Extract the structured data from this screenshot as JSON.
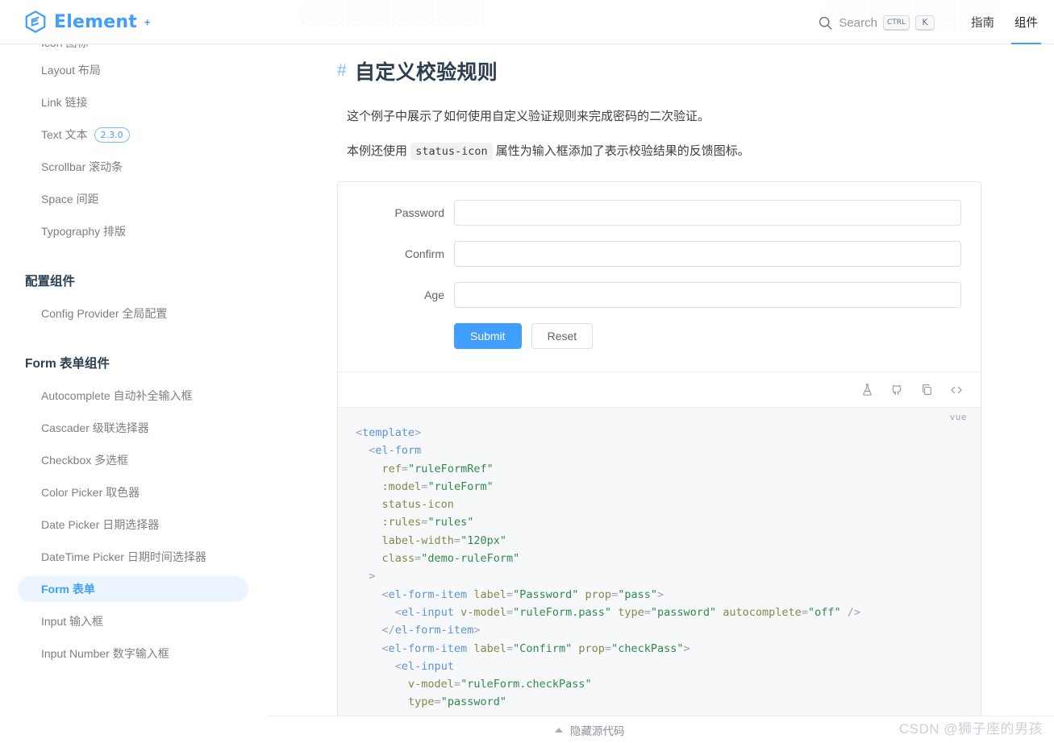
{
  "header": {
    "brand": "Element",
    "brand_plus": "+",
    "logo_icon": "element-hex-logo-icon",
    "search": {
      "icon": "search-icon",
      "label": "Search",
      "kbd_ctrl": "CTRL",
      "kbd_key": "K"
    },
    "nav": [
      {
        "label": "指南",
        "active": false
      },
      {
        "label": "组件",
        "active": true
      }
    ]
  },
  "sidebar": {
    "items": [
      {
        "label": "Icon 图标",
        "type": "link",
        "active": false,
        "clipped": true
      },
      {
        "label": "Layout 布局",
        "type": "link",
        "active": false
      },
      {
        "label": "Link 链接",
        "type": "link",
        "active": false
      },
      {
        "label": "Text 文本",
        "type": "link",
        "active": false,
        "badge": "2.3.0"
      },
      {
        "label": "Scrollbar 滚动条",
        "type": "link",
        "active": false
      },
      {
        "label": "Space 间距",
        "type": "link",
        "active": false
      },
      {
        "label": "Typography 排版",
        "type": "link",
        "active": false
      },
      {
        "label": "配置组件",
        "type": "group"
      },
      {
        "label": "Config Provider 全局配置",
        "type": "link",
        "active": false
      },
      {
        "label": "Form 表单组件",
        "type": "group"
      },
      {
        "label": "Autocomplete 自动补全输入框",
        "type": "link",
        "active": false
      },
      {
        "label": "Cascader 级联选择器",
        "type": "link",
        "active": false
      },
      {
        "label": "Checkbox 多选框",
        "type": "link",
        "active": false
      },
      {
        "label": "Color Picker 取色器",
        "type": "link",
        "active": false
      },
      {
        "label": "Date Picker 日期选择器",
        "type": "link",
        "active": false
      },
      {
        "label": "DateTime Picker 日期时间选择器",
        "type": "link",
        "active": false
      },
      {
        "label": "Form 表单",
        "type": "link",
        "active": true
      },
      {
        "label": "Input 输入框",
        "type": "link",
        "active": false
      },
      {
        "label": "Input Number 数字输入框",
        "type": "link",
        "active": false
      }
    ]
  },
  "main": {
    "heading_anchor": "#",
    "heading": "自定义校验规则",
    "paragraph_1": "这个例子中展示了如何使用自定义验证规则来完成密码的二次验证。",
    "paragraph_2_before": "本例还使用",
    "paragraph_2_code": "status-icon",
    "paragraph_2_after": "属性为输入框添加了表示校验结果的反馈图标。",
    "demo": {
      "fields": [
        {
          "label": "Password",
          "value": "",
          "placeholder": "",
          "type": "password",
          "name": "password-input"
        },
        {
          "label": "Confirm",
          "value": "",
          "placeholder": "",
          "type": "password",
          "name": "confirm-input"
        },
        {
          "label": "Age",
          "value": "",
          "placeholder": "",
          "type": "text",
          "name": "age-input"
        }
      ],
      "submit_label": "Submit",
      "reset_label": "Reset",
      "toolbar_icons": [
        {
          "name": "playground-flask-icon",
          "title": "在 Playground 中编辑"
        },
        {
          "name": "github-icon",
          "title": "在 GitHub 上查看"
        },
        {
          "name": "copy-icon",
          "title": "复制代码"
        },
        {
          "name": "code-brackets-icon",
          "title": "查看源代码"
        }
      ],
      "code_lang": "vue"
    },
    "footer": {
      "toggle_icon": "caret-up-icon",
      "toggle_label": "隐藏源代码"
    }
  },
  "code_lines": [
    [
      {
        "t": "punc",
        "v": "<"
      },
      {
        "t": "tag",
        "v": "template"
      },
      {
        "t": "punc",
        "v": ">"
      }
    ],
    [
      {
        "t": "plain",
        "v": "  "
      },
      {
        "t": "punc",
        "v": "<"
      },
      {
        "t": "tag",
        "v": "el-form"
      }
    ],
    [
      {
        "t": "plain",
        "v": "    "
      },
      {
        "t": "attr",
        "v": "ref"
      },
      {
        "t": "eq",
        "v": "="
      },
      {
        "t": "str",
        "v": "\"ruleFormRef\""
      }
    ],
    [
      {
        "t": "plain",
        "v": "    "
      },
      {
        "t": "attr",
        "v": ":model"
      },
      {
        "t": "eq",
        "v": "="
      },
      {
        "t": "str",
        "v": "\"ruleForm\""
      }
    ],
    [
      {
        "t": "plain",
        "v": "    "
      },
      {
        "t": "attr",
        "v": "status-icon"
      }
    ],
    [
      {
        "t": "plain",
        "v": "    "
      },
      {
        "t": "attr",
        "v": ":rules"
      },
      {
        "t": "eq",
        "v": "="
      },
      {
        "t": "str",
        "v": "\"rules\""
      }
    ],
    [
      {
        "t": "plain",
        "v": "    "
      },
      {
        "t": "attr",
        "v": "label-width"
      },
      {
        "t": "eq",
        "v": "="
      },
      {
        "t": "str",
        "v": "\"120px\""
      }
    ],
    [
      {
        "t": "plain",
        "v": "    "
      },
      {
        "t": "attr",
        "v": "class"
      },
      {
        "t": "eq",
        "v": "="
      },
      {
        "t": "str",
        "v": "\"demo-ruleForm\""
      }
    ],
    [
      {
        "t": "plain",
        "v": "  "
      },
      {
        "t": "punc",
        "v": ">"
      }
    ],
    [
      {
        "t": "plain",
        "v": "    "
      },
      {
        "t": "punc",
        "v": "<"
      },
      {
        "t": "tag",
        "v": "el-form-item"
      },
      {
        "t": "plain",
        "v": " "
      },
      {
        "t": "attr",
        "v": "label"
      },
      {
        "t": "eq",
        "v": "="
      },
      {
        "t": "str",
        "v": "\"Password\""
      },
      {
        "t": "plain",
        "v": " "
      },
      {
        "t": "attr",
        "v": "prop"
      },
      {
        "t": "eq",
        "v": "="
      },
      {
        "t": "str",
        "v": "\"pass\""
      },
      {
        "t": "punc",
        "v": ">"
      }
    ],
    [
      {
        "t": "plain",
        "v": "      "
      },
      {
        "t": "punc",
        "v": "<"
      },
      {
        "t": "tag",
        "v": "el-input"
      },
      {
        "t": "plain",
        "v": " "
      },
      {
        "t": "attr",
        "v": "v-model"
      },
      {
        "t": "eq",
        "v": "="
      },
      {
        "t": "str",
        "v": "\"ruleForm.pass\""
      },
      {
        "t": "plain",
        "v": " "
      },
      {
        "t": "attr",
        "v": "type"
      },
      {
        "t": "eq",
        "v": "="
      },
      {
        "t": "str",
        "v": "\"password\""
      },
      {
        "t": "plain",
        "v": " "
      },
      {
        "t": "attr",
        "v": "autocomplete"
      },
      {
        "t": "eq",
        "v": "="
      },
      {
        "t": "str",
        "v": "\"off\""
      },
      {
        "t": "plain",
        "v": " "
      },
      {
        "t": "punc",
        "v": "/>"
      }
    ],
    [
      {
        "t": "plain",
        "v": "    "
      },
      {
        "t": "punc",
        "v": "</"
      },
      {
        "t": "tag",
        "v": "el-form-item"
      },
      {
        "t": "punc",
        "v": ">"
      }
    ],
    [
      {
        "t": "plain",
        "v": "    "
      },
      {
        "t": "punc",
        "v": "<"
      },
      {
        "t": "tag",
        "v": "el-form-item"
      },
      {
        "t": "plain",
        "v": " "
      },
      {
        "t": "attr",
        "v": "label"
      },
      {
        "t": "eq",
        "v": "="
      },
      {
        "t": "str",
        "v": "\"Confirm\""
      },
      {
        "t": "plain",
        "v": " "
      },
      {
        "t": "attr",
        "v": "prop"
      },
      {
        "t": "eq",
        "v": "="
      },
      {
        "t": "str",
        "v": "\"checkPass\""
      },
      {
        "t": "punc",
        "v": ">"
      }
    ],
    [
      {
        "t": "plain",
        "v": "      "
      },
      {
        "t": "punc",
        "v": "<"
      },
      {
        "t": "tag",
        "v": "el-input"
      }
    ],
    [
      {
        "t": "plain",
        "v": "        "
      },
      {
        "t": "attr",
        "v": "v-model"
      },
      {
        "t": "eq",
        "v": "="
      },
      {
        "t": "str",
        "v": "\"ruleForm.checkPass\""
      }
    ],
    [
      {
        "t": "plain",
        "v": "        "
      },
      {
        "t": "attr",
        "v": "type"
      },
      {
        "t": "eq",
        "v": "="
      },
      {
        "t": "str",
        "v": "\"password\""
      }
    ]
  ],
  "watermark": "CSDN @狮子座的男孩",
  "colors": {
    "accent": "#409eff",
    "accent_soft": "#ecf5ff",
    "text": "#2c3e50",
    "muted": "#7c7f87",
    "border": "#e4e7ed",
    "code_bg": "#f6f8fa",
    "code_tag": "#5c93d6",
    "code_attr": "#83894b",
    "code_string": "#2f8a4e"
  }
}
